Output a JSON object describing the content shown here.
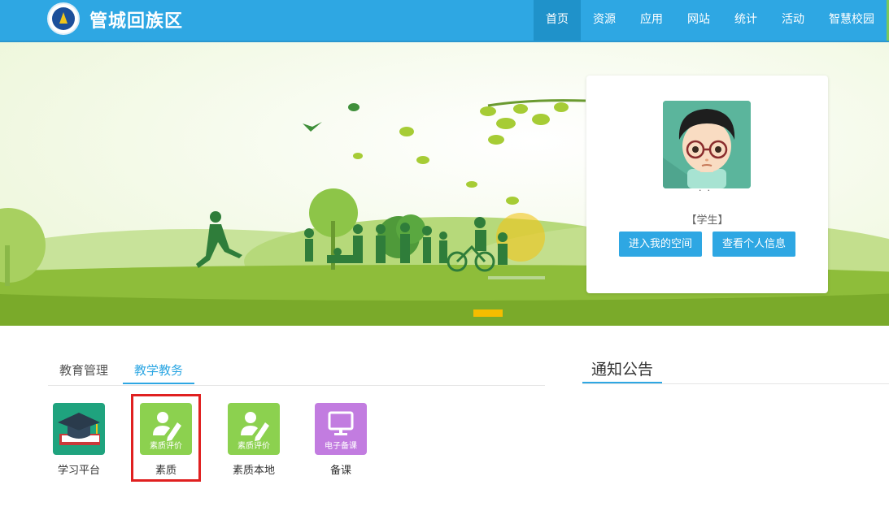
{
  "header": {
    "site_title": "管城回族区",
    "nav": [
      {
        "label": "首页",
        "active": true
      },
      {
        "label": "资源"
      },
      {
        "label": "应用"
      },
      {
        "label": "网站"
      },
      {
        "label": "统计"
      },
      {
        "label": "活动"
      },
      {
        "label": "智慧校园"
      }
    ]
  },
  "profile": {
    "name": "‘·’ · ‘’",
    "role": "【学生】",
    "btn_space": "进入我的空间",
    "btn_info": "查看个人信息"
  },
  "tabs": [
    {
      "label": "教育管理"
    },
    {
      "label": "教学教务",
      "active": true
    }
  ],
  "notice": {
    "title": "通知公告"
  },
  "apps": [
    {
      "label": "学习平台",
      "icon": "graduation-cap-book-icon",
      "color": "#1fa37e"
    },
    {
      "label": "素质",
      "sub": "素质评价",
      "icon": "user-pen-icon",
      "color": "#8cd14f"
    },
    {
      "label": "素质本地",
      "sub": "素质评价",
      "icon": "user-pen-icon",
      "color": "#8cd14f"
    },
    {
      "label": "备课",
      "sub": "电子备课",
      "icon": "monitor-icon",
      "color": "#c27ce0"
    }
  ],
  "colors": {
    "primary": "#2ea7e3",
    "highlight": "#e02020",
    "banner_grass": "#7aaa2a"
  }
}
